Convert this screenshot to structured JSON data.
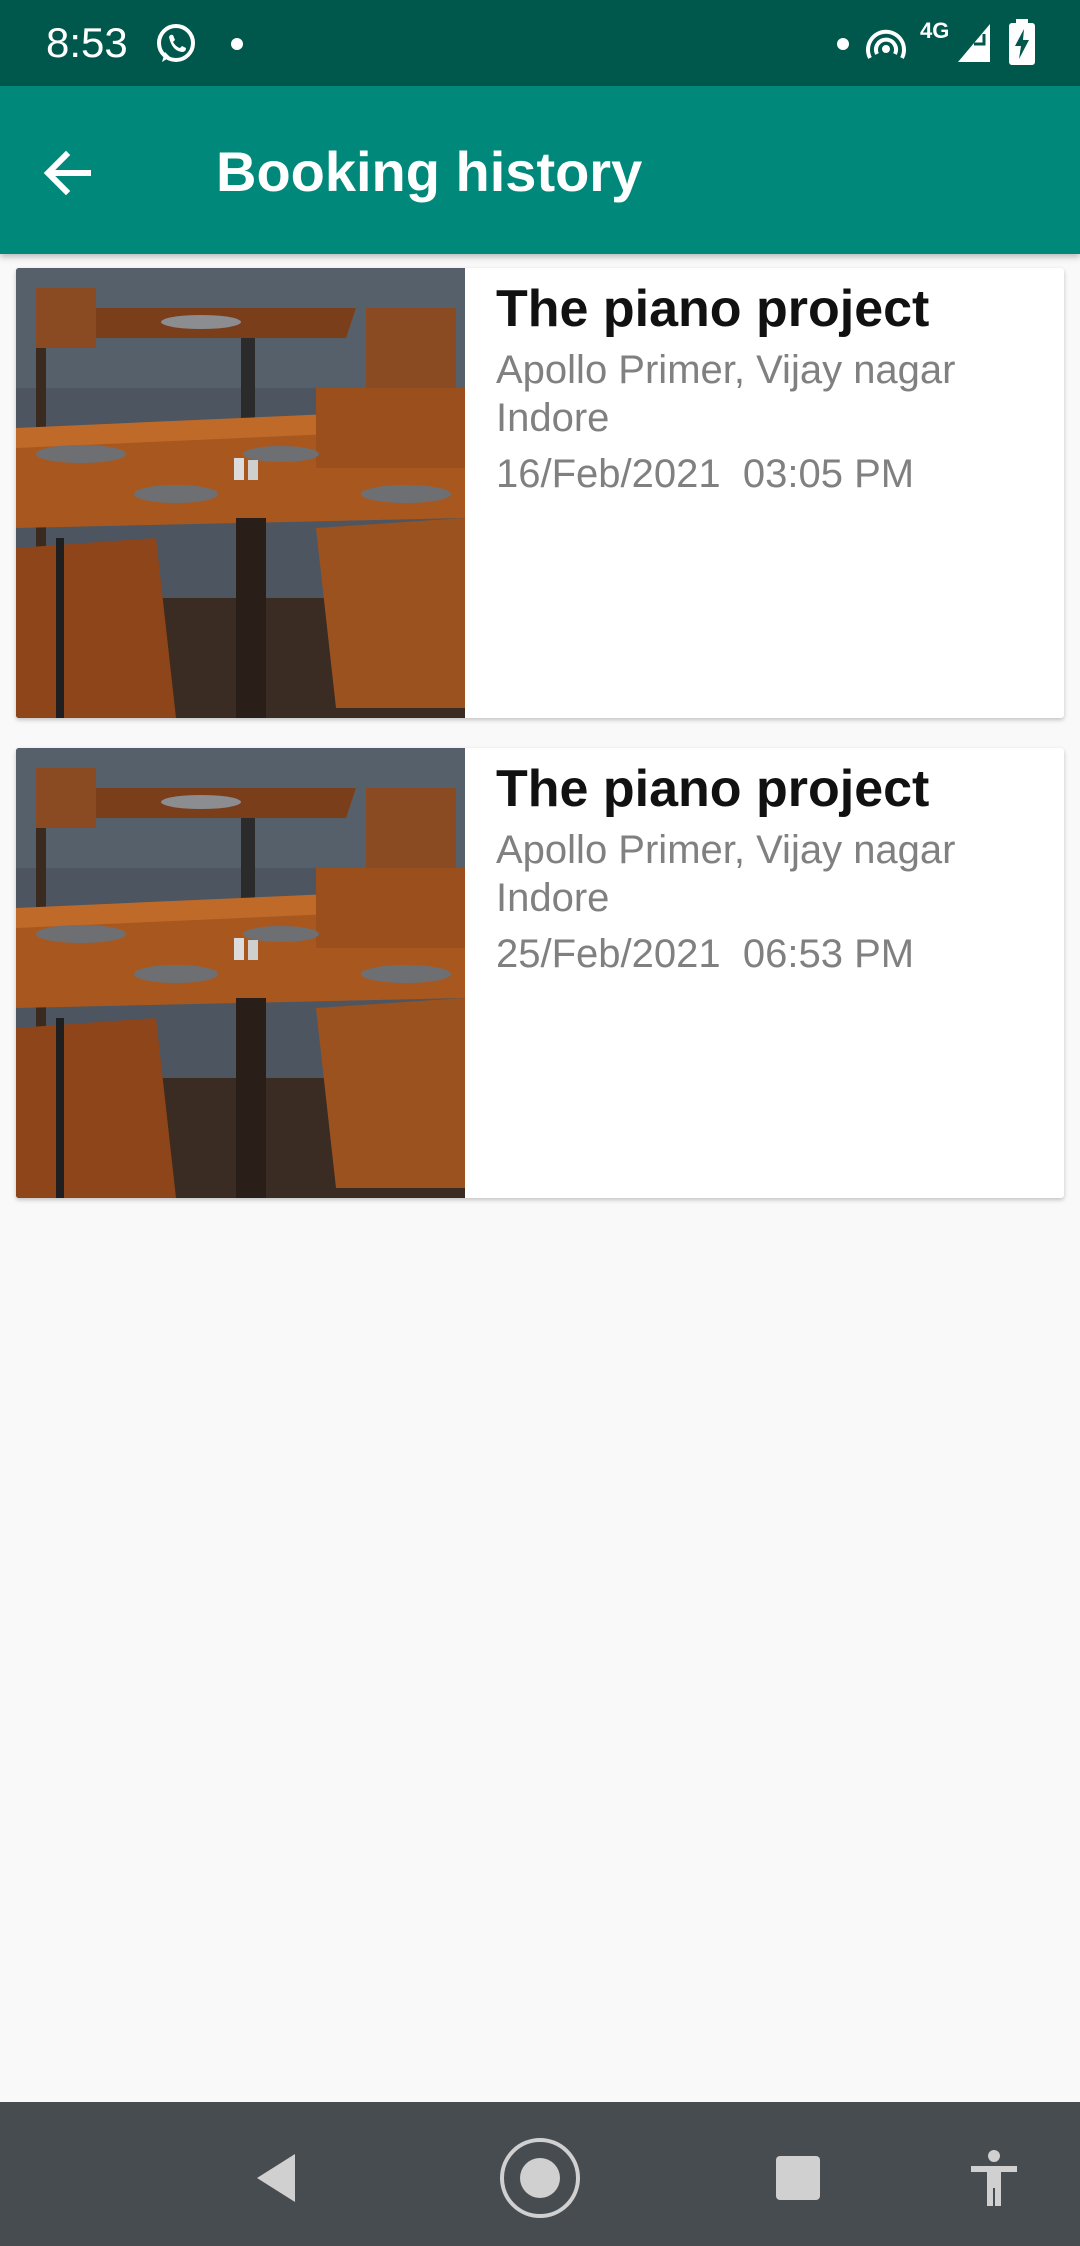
{
  "status_bar": {
    "time": "8:53",
    "network": "4G",
    "icons": [
      "whatsapp-icon",
      "notification-dot-icon",
      "hotspot-icon",
      "signal-icon",
      "battery-charging-icon"
    ]
  },
  "app_bar": {
    "title": "Booking history",
    "back_icon": "arrow-left-icon"
  },
  "bookings": [
    {
      "name": "The piano project",
      "address": "Apollo Primer, Vijay nagar Indore",
      "date": "16/Feb/2021",
      "time": "03:05 PM",
      "datetime": "16/Feb/2021  03:05 PM",
      "image": "restaurant-tables-photo"
    },
    {
      "name": "The piano project",
      "address": "Apollo Primer, Vijay nagar Indore",
      "date": "25/Feb/2021",
      "time": "06:53 PM",
      "datetime": "25/Feb/2021  06:53 PM",
      "image": "restaurant-tables-photo"
    }
  ],
  "nav_bar": {
    "buttons": [
      "back-triangle-icon",
      "home-circle-icon",
      "recents-square-icon",
      "accessibility-icon"
    ]
  },
  "colors": {
    "status_bar": "#00574b",
    "app_bar": "#00897b",
    "background": "#f9f9f9",
    "nav_bar": "#474c51",
    "secondary_text": "#808080"
  }
}
